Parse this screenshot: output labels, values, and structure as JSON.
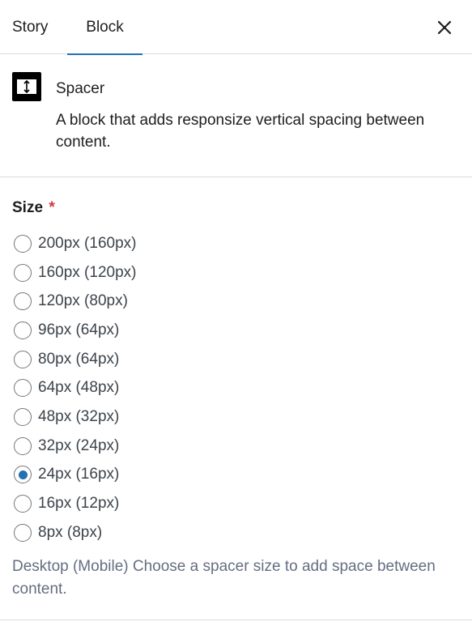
{
  "tabs": [
    {
      "label": "Story"
    },
    {
      "label": "Block",
      "active": true
    }
  ],
  "close_icon": "close-icon",
  "block": {
    "icon": "spacer-icon",
    "title": "Spacer",
    "description": "A block that adds responsize vertical spacing between content."
  },
  "size_field": {
    "label": "Size",
    "required_marker": "*",
    "options": [
      {
        "label": "200px (160px)",
        "checked": false
      },
      {
        "label": "160px (120px)",
        "checked": false
      },
      {
        "label": "120px (80px)",
        "checked": false
      },
      {
        "label": "96px (64px)",
        "checked": false
      },
      {
        "label": "80px (64px)",
        "checked": false
      },
      {
        "label": "64px (48px)",
        "checked": false
      },
      {
        "label": "48px (32px)",
        "checked": false
      },
      {
        "label": "32px (24px)",
        "checked": false
      },
      {
        "label": "24px (16px)",
        "checked": true
      },
      {
        "label": "16px (12px)",
        "checked": false
      },
      {
        "label": "8px (8px)",
        "checked": false
      }
    ],
    "help_text": "Desktop (Mobile) Choose a spacer size to add space between content."
  },
  "colors": {
    "accent": "#2271b1",
    "required": "#d63638",
    "help_text": "#646e82"
  }
}
